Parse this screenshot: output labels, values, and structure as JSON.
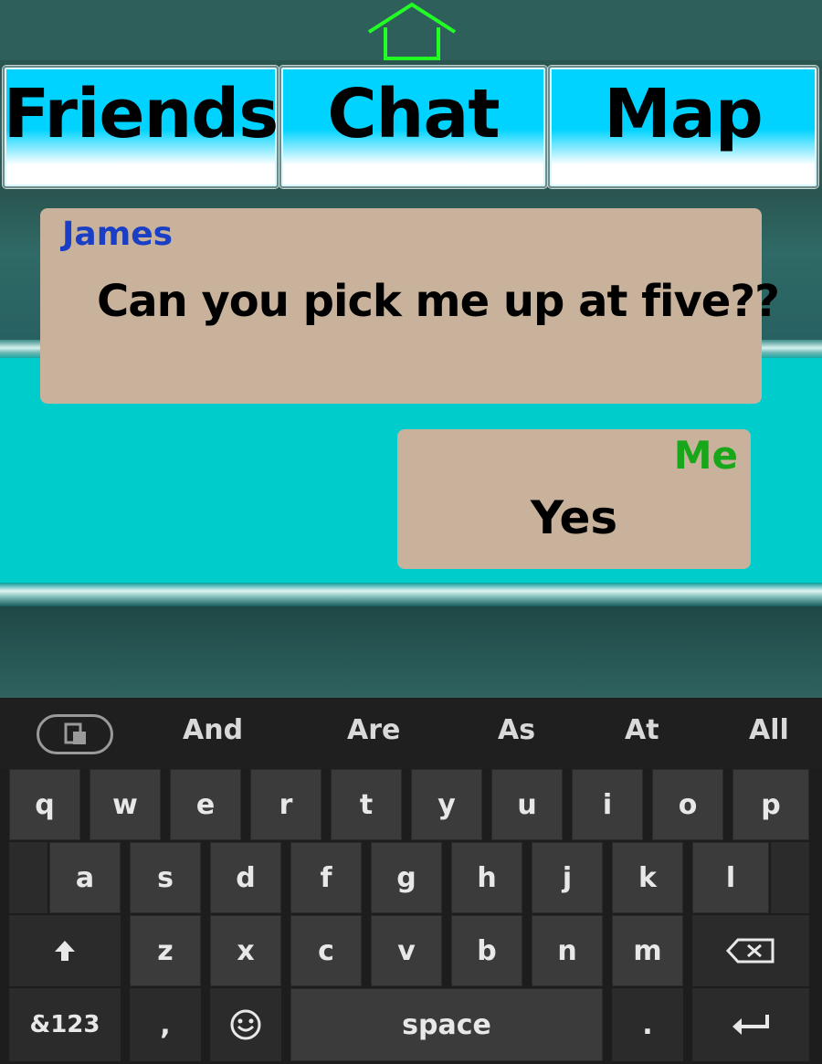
{
  "header": {
    "home_icon": "home-icon",
    "home_color": "#22ff22"
  },
  "tabs": [
    {
      "label": "Friends"
    },
    {
      "label": "Chat"
    },
    {
      "label": "Map"
    }
  ],
  "messages": [
    {
      "sender": "James",
      "text": "Can you pick me up at five??",
      "sender_color": "#1a3fc4"
    },
    {
      "sender": "Me",
      "text": "Yes",
      "sender_color": "#18a61a"
    }
  ],
  "keyboard": {
    "suggestions": [
      "And",
      "Are",
      "As",
      "At",
      "All"
    ],
    "row1": [
      "q",
      "w",
      "e",
      "r",
      "t",
      "y",
      "u",
      "i",
      "o",
      "p"
    ],
    "row2": [
      "a",
      "s",
      "d",
      "f",
      "g",
      "h",
      "j",
      "k",
      "l"
    ],
    "row3": [
      "z",
      "x",
      "c",
      "v",
      "b",
      "n",
      "m"
    ],
    "symbols_label": "&123",
    "comma": ",",
    "space_label": "space",
    "period": "."
  }
}
